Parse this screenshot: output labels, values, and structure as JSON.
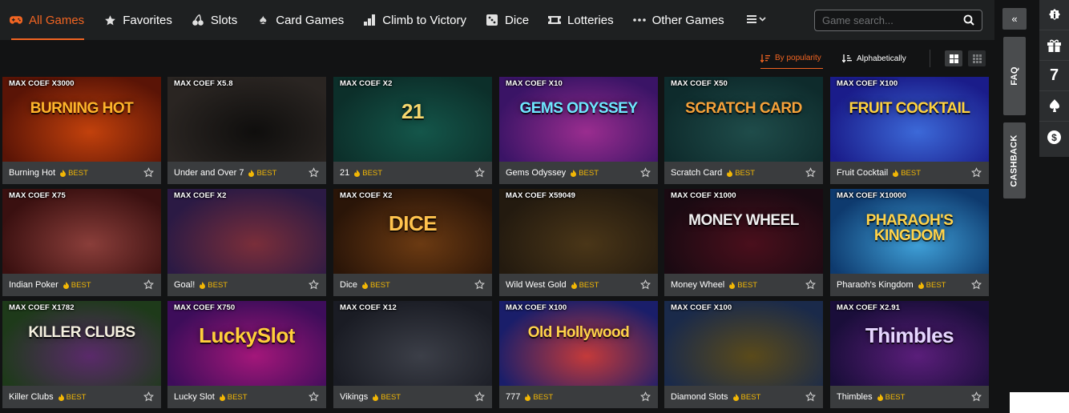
{
  "nav": {
    "items": [
      {
        "label": "All Games",
        "icon": "gamepad-icon"
      },
      {
        "label": "Favorites",
        "icon": "star-icon"
      },
      {
        "label": "Slots",
        "icon": "cherries-icon"
      },
      {
        "label": "Card Games",
        "icon": "spade-icon"
      },
      {
        "label": "Climb to Victory",
        "icon": "bar-steps-icon"
      },
      {
        "label": "Dice",
        "icon": "dice-icon"
      },
      {
        "label": "Lotteries",
        "icon": "ticket-icon"
      },
      {
        "label": "Other Games",
        "icon": "dots-icon"
      }
    ],
    "more_icon": "menu-dropdown-icon"
  },
  "search": {
    "placeholder": "Game search..."
  },
  "sort": {
    "popularity": "By popularity",
    "alpha": "Alphabetically"
  },
  "badge_label": "BEST",
  "games": [
    {
      "name": "Burning Hot",
      "coef": "MAX COEF X3000",
      "art": "BURNING HOT",
      "bg": [
        "#5a1406",
        "#c2410c"
      ],
      "artColor": "#ffb52b"
    },
    {
      "name": "Under and Over 7",
      "coef": "MAX COEF X5.8",
      "art": "",
      "bg": [
        "#2a2522",
        "#0f0e0d"
      ],
      "artColor": "#ffffff"
    },
    {
      "name": "21",
      "coef": "MAX COEF X2",
      "art": "21",
      "bg": [
        "#0c2f2a",
        "#14564a"
      ],
      "artColor": "#f5d76e"
    },
    {
      "name": "Gems Odyssey",
      "coef": "MAX COEF X10",
      "art": "GEMS ODYSSEY",
      "bg": [
        "#3a1466",
        "#9a2d8f"
      ],
      "artColor": "#6ee7ff"
    },
    {
      "name": "Scratch Card",
      "coef": "MAX COEF X50",
      "art": "SCRATCH CARD",
      "bg": [
        "#0e2b2c",
        "#1f4c4a"
      ],
      "artColor": "#f6a23a"
    },
    {
      "name": "Fruit Cocktail",
      "coef": "MAX COEF X100",
      "art": "FRUIT COCKTAIL",
      "bg": [
        "#1a1c8a",
        "#3c69d8"
      ],
      "artColor": "#ffd23f"
    },
    {
      "name": "Indian Poker",
      "coef": "MAX COEF X75",
      "art": "",
      "bg": [
        "#3a1010",
        "#8a3e3a"
      ],
      "artColor": "#ffffff"
    },
    {
      "name": "Goal!",
      "coef": "MAX COEF X2",
      "art": "",
      "bg": [
        "#2b1a44",
        "#7a2e3a"
      ],
      "artColor": "#ffffff"
    },
    {
      "name": "Dice",
      "coef": "MAX COEF X2",
      "art": "DICE",
      "bg": [
        "#2a1508",
        "#6b3a12"
      ],
      "artColor": "#ffc34d"
    },
    {
      "name": "Wild West Gold",
      "coef": "MAX COEF X59049",
      "art": "",
      "bg": [
        "#231a0f",
        "#4a3618"
      ],
      "artColor": "#e2a93b"
    },
    {
      "name": "Money Wheel",
      "coef": "MAX COEF X1000",
      "art": "MONEY WHEEL",
      "bg": [
        "#1a0a12",
        "#4a0f1c"
      ],
      "artColor": "#f0f0f0"
    },
    {
      "name": "Pharaoh's Kingdom",
      "coef": "MAX COEF X10000",
      "art": "PHARAOH'S KINGDOM",
      "bg": [
        "#0e3a6e",
        "#3fa0d8"
      ],
      "artColor": "#ffd34a"
    },
    {
      "name": "Killer Clubs",
      "coef": "MAX COEF X1782",
      "art": "KILLER CLUBS",
      "bg": [
        "#1e3a1a",
        "#5a2a6a"
      ],
      "artColor": "#f5f0e0"
    },
    {
      "name": "Lucky Slot",
      "coef": "MAX COEF X750",
      "art": "LuckySlot",
      "bg": [
        "#3d0d5a",
        "#a3177a"
      ],
      "artColor": "#ffcf3a"
    },
    {
      "name": "Vikings",
      "coef": "MAX COEF X12",
      "art": "",
      "bg": [
        "#1a1c24",
        "#3c3f48"
      ],
      "artColor": "#ffffff"
    },
    {
      "name": "777",
      "coef": "MAX COEF X100",
      "art": "Old Hollywood",
      "bg": [
        "#1a1e6a",
        "#c43a3a"
      ],
      "artColor": "#ffd24a"
    },
    {
      "name": "Diamond Slots",
      "coef": "MAX COEF X100",
      "art": "",
      "bg": [
        "#1a2a4a",
        "#5a4a1a"
      ],
      "artColor": "#ffffff"
    },
    {
      "name": "Thimbles",
      "coef": "MAX COEF X2.91",
      "art": "Thimbles",
      "bg": [
        "#1a0e3a",
        "#5a1e7a"
      ],
      "artColor": "#e6d6ff"
    }
  ],
  "side": {
    "faq": "FAQ",
    "cashback": "CASHBACK"
  },
  "rightbar": [
    {
      "icon": "info-badge-icon"
    },
    {
      "icon": "gift-icon"
    },
    {
      "icon": "seven-icon",
      "text": "7"
    },
    {
      "icon": "poker-chip-icon"
    },
    {
      "icon": "dollar-coin-icon"
    }
  ],
  "colors": {
    "accent": "#f26522",
    "best": "#f2b705"
  }
}
